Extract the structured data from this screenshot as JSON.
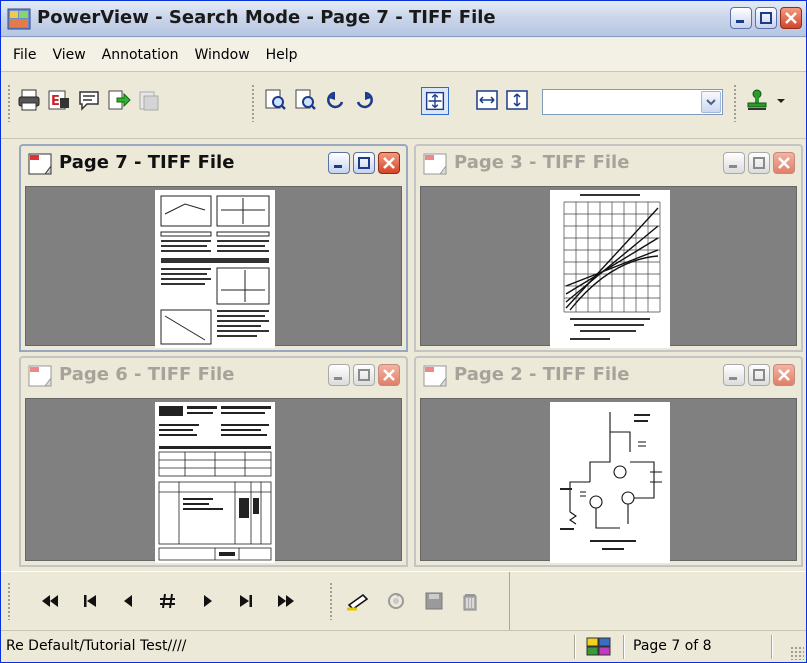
{
  "window": {
    "title": "PowerView - Search Mode - Page 7 - TIFF File"
  },
  "menu": [
    {
      "label": "File"
    },
    {
      "label": "View"
    },
    {
      "label": "Annotation"
    },
    {
      "label": "Window"
    },
    {
      "label": "Help"
    }
  ],
  "toolbar": {
    "icons": [
      "print-icon",
      "edit-icon",
      "comment-icon",
      "export-icon",
      "folder-icon",
      "zoom-in-icon",
      "zoom-out-icon",
      "rotate-left-icon",
      "rotate-right-icon",
      "fit-page-icon",
      "fit-width-icon",
      "fit-height-icon",
      "stamp-icon"
    ],
    "zoom_select_value": ""
  },
  "documents": [
    {
      "title": "Page 7 - TIFF File",
      "active": true
    },
    {
      "title": "Page 3 - TIFF File",
      "active": false
    },
    {
      "title": "Page 6 - TIFF File",
      "active": false
    },
    {
      "title": "Page 2 - TIFF File",
      "active": false
    }
  ],
  "nav": {
    "icons": [
      "rewind-icon",
      "first-page-icon",
      "prev-page-icon",
      "goto-page-icon",
      "next-page-icon",
      "last-page-icon",
      "fast-forward-icon",
      "highlighter-icon",
      "refresh-icon",
      "save-icon",
      "delete-icon"
    ]
  },
  "status": {
    "path": "Re Default/Tutorial Test////",
    "page": "Page 7 of 8"
  },
  "colors": {
    "titlebar": "#cbd6ea",
    "chrome": "#ece9d8",
    "close": "#d5462a"
  }
}
